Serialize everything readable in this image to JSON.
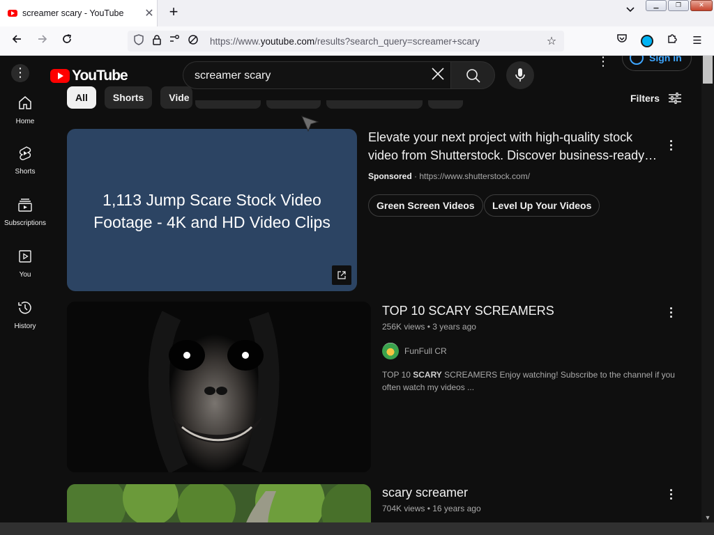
{
  "browser": {
    "tab_title": "screamer scary - YouTube",
    "url_prefix": "https://www.",
    "url_domain": "youtube.com",
    "url_suffix": "/results?search_query=screamer+scary"
  },
  "youtube": {
    "logo_text": "YouTube",
    "search_value": "screamer scary",
    "signin_label": "Sign in",
    "filters_label": "Filters",
    "chips": [
      {
        "label": "All"
      },
      {
        "label": "Shorts"
      },
      {
        "label": "Vide"
      }
    ],
    "sidebar": [
      {
        "label": "Home"
      },
      {
        "label": "Shorts"
      },
      {
        "label": "Subscriptions"
      },
      {
        "label": "You"
      },
      {
        "label": "History"
      }
    ]
  },
  "ad": {
    "card_title": "1,113 Jump Scare Stock Video Footage - 4K and HD Video Clips",
    "headline": "Elevate your next project with high-quality stock video from Shutterstock. Discover business-ready…",
    "sponsored": "Sponsored",
    "separator": " · ",
    "ad_url": "https://www.shutterstock.com/",
    "buttons": [
      {
        "label": "Green Screen Videos"
      },
      {
        "label": "Level Up Your Videos"
      }
    ]
  },
  "videos": [
    {
      "title": "TOP 10 SCARY SCREAMERS",
      "views": "256K views",
      "age": "3 years ago",
      "channel": "FunFull CR",
      "desc_pre": "TOP 10 ",
      "desc_bold": "SCARY",
      "desc_post": " SCREAMERS Enjoy watching! Subscribe to the channel if you often watch my videos ..."
    },
    {
      "title": "scary screamer",
      "views": "704K views",
      "age": "16 years ago"
    }
  ],
  "meta_dot": " • ",
  "colors": {
    "yt_bg": "#0f0f0f",
    "accent_red": "#ff0000",
    "ad_card": "#2c4463",
    "link_blue": "#3ea6ff"
  }
}
